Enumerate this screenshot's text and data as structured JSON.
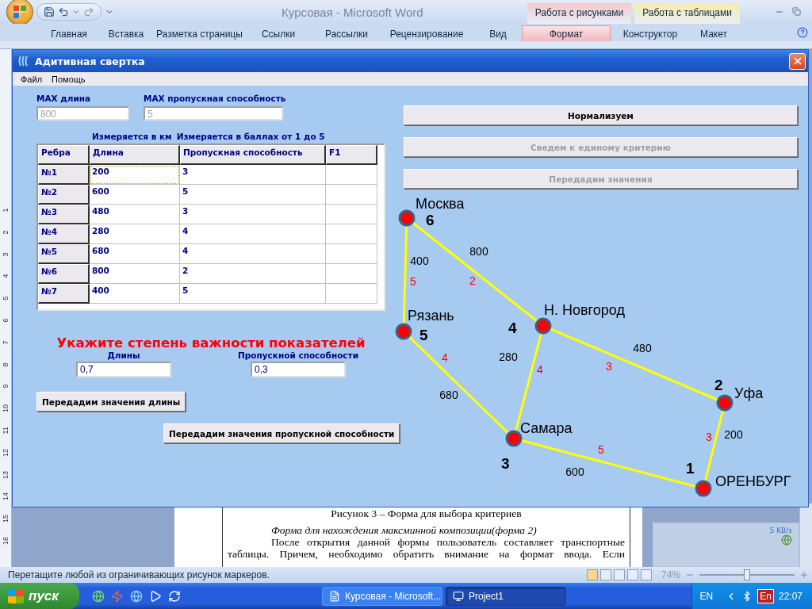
{
  "word": {
    "title": "Курсовая - Microsoft Word",
    "context_tabs": [
      {
        "label": "Работа с рисунками",
        "color": "#f4c9cd"
      },
      {
        "label": "Работа с таблицами",
        "color": "#f7eca8"
      }
    ],
    "ribbon_tabs": [
      {
        "label": "Главная",
        "selected": false
      },
      {
        "label": "Вставка",
        "selected": false
      },
      {
        "label": "Разметка страницы",
        "selected": false
      },
      {
        "label": "Ссылки",
        "selected": false
      },
      {
        "label": "Рассылки",
        "selected": false
      },
      {
        "label": "Рецензирование",
        "selected": false
      },
      {
        "label": "Вид",
        "selected": false
      },
      {
        "label": "Формат",
        "selected": true
      },
      {
        "label": "Конструктор",
        "selected": false
      },
      {
        "label": "Макет",
        "selected": false
      }
    ],
    "ruler_marks": [
      "1",
      "2",
      "3",
      "4",
      "5",
      "6",
      "7",
      "8",
      "9",
      "10",
      "11",
      "12",
      "13",
      "14",
      "15",
      "16"
    ],
    "document": {
      "caption": "Рисунок 3 – Форма для выбора критериев",
      "heading": "Форма для нахождения максминной композиции(форма 2)",
      "lines": [
        "После открытия данной формы пользователь составляет транспортные",
        "таблицы. Причем, необходимо обратить внимание на формат ввода. Если"
      ]
    },
    "network_widget": {
      "speed": "5 KB/s"
    },
    "status_bar": {
      "message": "Перетащите любой из ограничивающих рисунок маркеров.",
      "zoom": "74%",
      "zoom_slider": {
        "level": 0.5
      }
    }
  },
  "dialog": {
    "title": "Адитивная свертка",
    "menu": [
      "Файл",
      "Помощь"
    ],
    "max_fields": [
      {
        "label": "MAX длина",
        "value": "800",
        "disabled": true
      },
      {
        "label": "MAX пропускная способность",
        "value": "5",
        "disabled": true
      }
    ],
    "units": [
      "Измеряется в км",
      "Измеряется в баллах от 1 до 5"
    ],
    "table": {
      "columns": [
        "Ребра",
        "Длина",
        "Пропускная способность",
        "F1"
      ],
      "rows": [
        {
          "edge": "№1",
          "length": "200",
          "capacity": "3",
          "focused": true
        },
        {
          "edge": "№2",
          "length": "600",
          "capacity": "5",
          "focused": false
        },
        {
          "edge": "№3",
          "length": "480",
          "capacity": "3",
          "focused": false
        },
        {
          "edge": "№4",
          "length": "280",
          "capacity": "4",
          "focused": false
        },
        {
          "edge": "№5",
          "length": "680",
          "capacity": "4",
          "focused": false
        },
        {
          "edge": "№6",
          "length": "800",
          "capacity": "2",
          "focused": false
        },
        {
          "edge": "№7",
          "length": "400",
          "capacity": "5",
          "focused": false
        }
      ]
    },
    "weights": {
      "title": "Укажите степень важности показателей",
      "fields": [
        {
          "label": "Длины",
          "value": "0,7"
        },
        {
          "label": "Пропускной способности",
          "value": "0,3"
        }
      ]
    },
    "left_buttons": [
      {
        "label": "Передадим значения длины",
        "disabled": false
      },
      {
        "label": "Передадим значения пропускной способности",
        "disabled": false
      }
    ],
    "right_buttons": [
      {
        "label": "Нормализуем",
        "disabled": false
      },
      {
        "label": "Сведем к единому критерию",
        "disabled": true
      },
      {
        "label": "Передадим значения",
        "disabled": true
      }
    ],
    "graph": {
      "nodes": [
        {
          "name": "Москва",
          "number": "6"
        },
        {
          "name": "Рязань",
          "number": "5"
        },
        {
          "name": "Н. Новгород",
          "number": "4"
        },
        {
          "name": "Самара",
          "number": "3"
        },
        {
          "name": "Уфа",
          "number": "2"
        },
        {
          "name": "ОРЕНБУРГ",
          "number": "1"
        }
      ],
      "edges": [
        {
          "length": "400",
          "score": "5"
        },
        {
          "length": "800",
          "score": "2"
        },
        {
          "length": "680",
          "score": "4"
        },
        {
          "length": "280",
          "score": "4"
        },
        {
          "length": "480",
          "score": "3"
        },
        {
          "length": "600",
          "score": "5"
        },
        {
          "length": "200",
          "score": "3"
        }
      ]
    }
  },
  "taskbar": {
    "start": "пуск",
    "tasks": [
      {
        "label": "Курсовая - Microsoft...",
        "selected": false
      },
      {
        "label": "Project1",
        "selected": true
      }
    ],
    "language": "EN",
    "ime": "En",
    "clock": "22:07"
  }
}
